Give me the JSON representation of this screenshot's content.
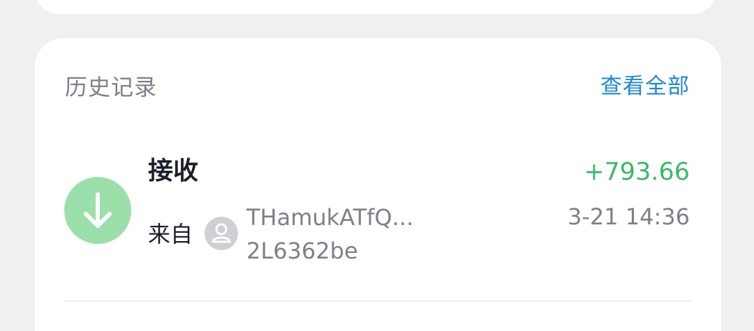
{
  "history": {
    "title": "历史记录",
    "view_all_label": "查看全部",
    "transactions": [
      {
        "type": "接收",
        "icon": "arrow-down-icon",
        "icon_color": "#9bdfaa",
        "from_label": "来自",
        "avatar_icon": "user-icon",
        "address_line1": "THamukATfQ...",
        "address_line2": "2L6362be",
        "amount": "+793.66",
        "amount_color": "#3cb768",
        "time": "3-21 14:36"
      }
    ]
  },
  "colors": {
    "background": "#eff0f2",
    "card": "#ffffff",
    "accent_link": "#1d87db",
    "muted_text": "#7d808a",
    "primary_text": "#1c1e2b"
  }
}
